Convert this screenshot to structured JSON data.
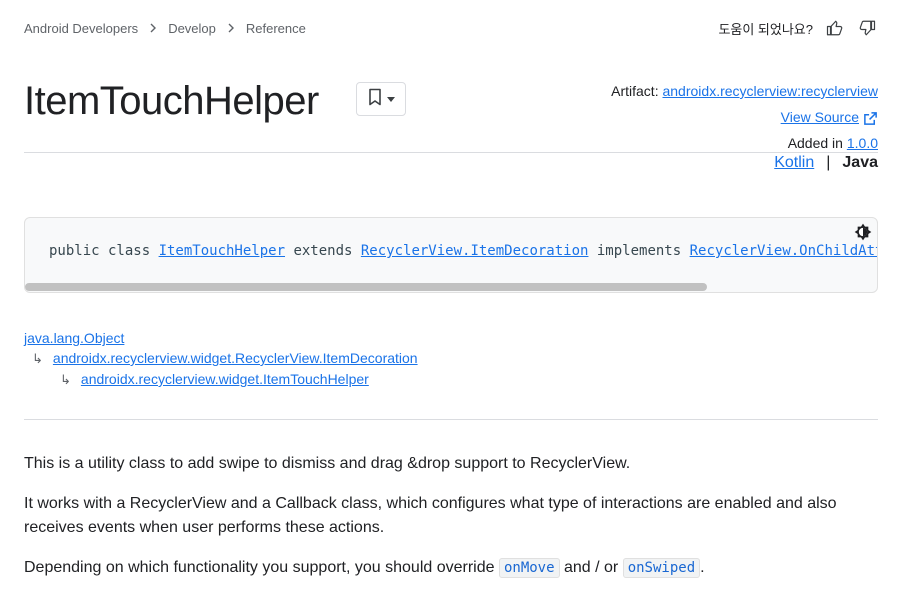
{
  "breadcrumb": {
    "items": [
      "Android Developers",
      "Develop",
      "Reference"
    ],
    "separator": ">"
  },
  "feedback": {
    "question": "도움이 되었나요?",
    "thumbs_up_icon": "thumb-up-icon",
    "thumbs_down_icon": "thumb-down-icon"
  },
  "page": {
    "title": "ItemTouchHelper",
    "bookmark_icon": "bookmark-icon"
  },
  "meta": {
    "artifact_label": "Artifact: ",
    "artifact_value": "androidx.recyclerview:recyclerview",
    "view_source": "View Source",
    "added_in_label": "Added in ",
    "added_in_version": "1.0.0"
  },
  "language": {
    "kotlin": "Kotlin",
    "divider": "|",
    "java": "Java"
  },
  "signature": {
    "prefix": "public class ",
    "class_name": "ItemTouchHelper",
    "extends_kw": " extends ",
    "parent": "RecyclerView.ItemDecoration",
    "implements_kw": " implements ",
    "interface": "RecyclerView.OnChildAttachStateChangeListener"
  },
  "hierarchy": {
    "level1": "java.lang.Object",
    "level2": "androidx.recyclerview.widget.RecyclerView.ItemDecoration",
    "level3": "androidx.recyclerview.widget.ItemTouchHelper",
    "arrow": "↳"
  },
  "body": {
    "p1": "This is a utility class to add swipe to dismiss and drag &drop support to RecyclerView.",
    "p2": "It works with a RecyclerView and a Callback class, which configures what type of interactions are enabled and also receives events when user performs these actions.",
    "p3_prefix": "Depending on which functionality you support, you should override ",
    "p3_code1": "onMove",
    "p3_mid": " and / or ",
    "p3_code2": "onSwiped",
    "p3_suffix": "."
  },
  "colors": {
    "link": "#1a73e8",
    "text": "#202124",
    "muted": "#5f6368",
    "code_bg": "#f8f9fa"
  }
}
